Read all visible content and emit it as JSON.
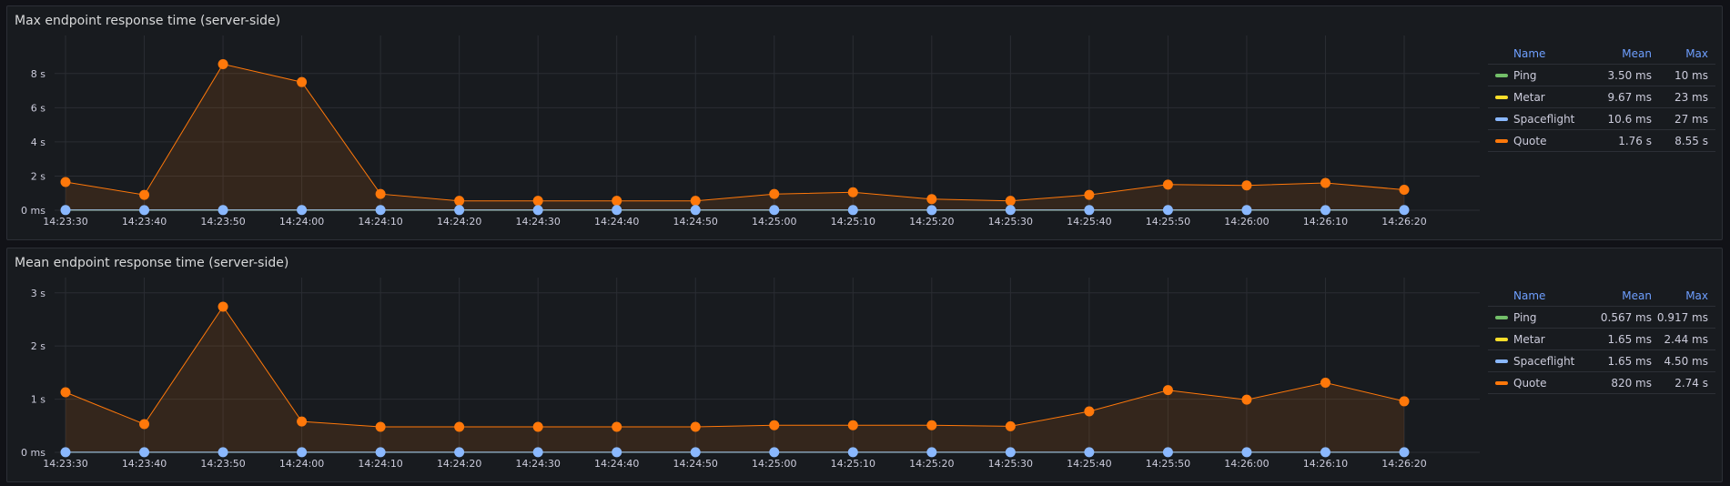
{
  "panels": [
    {
      "title": "Max endpoint response time (server-side)",
      "legend": {
        "headers": {
          "name": "Name",
          "mean": "Mean",
          "max": "Max"
        },
        "rows": [
          {
            "name": "Ping",
            "mean": "3.50 ms",
            "max": "10 ms",
            "color": "#73bf69"
          },
          {
            "name": "Metar",
            "mean": "9.67 ms",
            "max": "23 ms",
            "color": "#fade2a"
          },
          {
            "name": "Spaceflight",
            "mean": "10.6 ms",
            "max": "27 ms",
            "color": "#8ab8ff"
          },
          {
            "name": "Quote",
            "mean": "1.76 s",
            "max": "8.55 s",
            "color": "#ff780a"
          }
        ]
      }
    },
    {
      "title": "Mean endpoint response time (server-side)",
      "legend": {
        "headers": {
          "name": "Name",
          "mean": "Mean",
          "max": "Max"
        },
        "rows": [
          {
            "name": "Ping",
            "mean": "0.567 ms",
            "max": "0.917 ms",
            "color": "#73bf69"
          },
          {
            "name": "Metar",
            "mean": "1.65 ms",
            "max": "2.44 ms",
            "color": "#fade2a"
          },
          {
            "name": "Spaceflight",
            "mean": "1.65 ms",
            "max": "4.50 ms",
            "color": "#8ab8ff"
          },
          {
            "name": "Quote",
            "mean": "820 ms",
            "max": "2.74 s",
            "color": "#ff780a"
          }
        ]
      }
    }
  ],
  "chart_data": [
    {
      "type": "line",
      "title": "Max endpoint response time (server-side)",
      "x": [
        "14:23:30",
        "14:23:40",
        "14:23:50",
        "14:24:00",
        "14:24:10",
        "14:24:20",
        "14:24:30",
        "14:24:40",
        "14:24:50",
        "14:25:00",
        "14:25:10",
        "14:25:20",
        "14:25:30",
        "14:25:40",
        "14:25:50",
        "14:26:00",
        "14:26:10",
        "14:26:20"
      ],
      "yticks": [
        "0 ms",
        "2 s",
        "4 s",
        "6 s",
        "8 s"
      ],
      "ylim": [
        0,
        9.8
      ],
      "y_unit": "s",
      "grid": true,
      "legend_placement": "right",
      "series": [
        {
          "name": "Ping",
          "color": "#73bf69",
          "values": [
            0.004,
            0.003,
            0.003,
            0.003,
            0.003,
            0.004,
            0.003,
            0.003,
            0.004,
            0.003,
            0.004,
            0.004,
            0.003,
            0.003,
            0.004,
            0.003,
            0.003,
            0.004
          ]
        },
        {
          "name": "Metar",
          "color": "#fade2a",
          "values": [
            0.012,
            0.008,
            0.01,
            0.009,
            0.012,
            0.008,
            0.01,
            0.009,
            0.011,
            0.008,
            0.01,
            0.009,
            0.012,
            0.008,
            0.01,
            0.009,
            0.011,
            0.01
          ]
        },
        {
          "name": "Spaceflight",
          "color": "#8ab8ff",
          "values": [
            0.01,
            0.009,
            0.01,
            0.011,
            0.012,
            0.01,
            0.009,
            0.011,
            0.01,
            0.012,
            0.01,
            0.009,
            0.011,
            0.01,
            0.012,
            0.01,
            0.009,
            0.011
          ]
        },
        {
          "name": "Quote",
          "color": "#ff780a",
          "values": [
            1.65,
            0.9,
            8.55,
            7.5,
            0.95,
            0.55,
            0.55,
            0.55,
            0.55,
            0.95,
            1.05,
            0.65,
            0.55,
            0.9,
            1.5,
            1.45,
            1.6,
            1.2
          ]
        }
      ]
    },
    {
      "type": "line",
      "title": "Mean endpoint response time (server-side)",
      "x": [
        "14:23:30",
        "14:23:40",
        "14:23:50",
        "14:24:00",
        "14:24:10",
        "14:24:20",
        "14:24:30",
        "14:24:40",
        "14:24:50",
        "14:25:00",
        "14:25:10",
        "14:25:20",
        "14:25:30",
        "14:25:40",
        "14:25:50",
        "14:26:00",
        "14:26:10",
        "14:26:20"
      ],
      "yticks": [
        "0 ms",
        "1 s",
        "2 s",
        "3 s"
      ],
      "ylim": [
        0,
        3.15
      ],
      "y_unit": "s",
      "grid": true,
      "legend_placement": "right",
      "series": [
        {
          "name": "Ping",
          "color": "#73bf69",
          "values": [
            0.0006,
            0.0005,
            0.0006,
            0.0006,
            0.0005,
            0.0006,
            0.0006,
            0.0005,
            0.0006,
            0.0006,
            0.0005,
            0.0006,
            0.0006,
            0.0005,
            0.0006,
            0.0006,
            0.0005,
            0.0006
          ]
        },
        {
          "name": "Metar",
          "color": "#fade2a",
          "values": [
            0.0017,
            0.0015,
            0.0018,
            0.0016,
            0.0017,
            0.0015,
            0.0016,
            0.0017,
            0.0015,
            0.0018,
            0.0016,
            0.0017,
            0.0015,
            0.0016,
            0.0017,
            0.0016,
            0.0017,
            0.0016
          ]
        },
        {
          "name": "Spaceflight",
          "color": "#8ab8ff",
          "values": [
            0.0017,
            0.0015,
            0.0018,
            0.0016,
            0.0017,
            0.0015,
            0.0016,
            0.0017,
            0.0015,
            0.0018,
            0.0016,
            0.0017,
            0.0015,
            0.0016,
            0.0017,
            0.0016,
            0.0017,
            0.0016
          ]
        },
        {
          "name": "Quote",
          "color": "#ff780a",
          "values": [
            1.13,
            0.53,
            2.74,
            0.58,
            0.48,
            0.48,
            0.48,
            0.48,
            0.48,
            0.51,
            0.51,
            0.51,
            0.49,
            0.77,
            1.17,
            0.99,
            1.31,
            0.96
          ]
        }
      ]
    }
  ]
}
